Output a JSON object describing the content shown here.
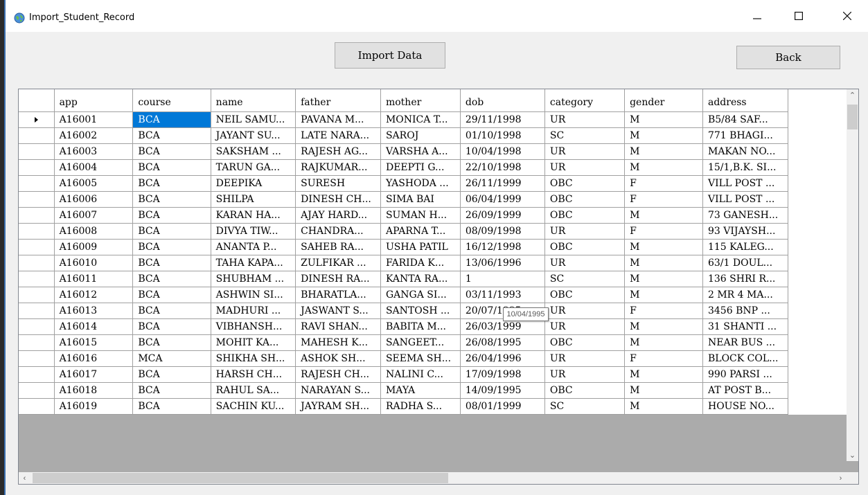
{
  "window": {
    "title": "Import_Student_Record",
    "minimize_icon": "minimize-icon",
    "maximize_icon": "maximize-icon",
    "close_icon": "close-icon"
  },
  "buttons": {
    "import": "Import Data",
    "back": "Back"
  },
  "table": {
    "columns": [
      "app",
      "course",
      "name",
      "father",
      "mother",
      "dob",
      "category",
      "gender",
      "address"
    ],
    "rows": [
      [
        "A16001",
        "BCA",
        "NEIL SAMU...",
        "PAVANA M...",
        "MONICA T...",
        "29/11/1998",
        "UR",
        "M",
        "B5/84 SAF..."
      ],
      [
        "A16002",
        "BCA",
        "JAYANT SU...",
        "LATE NARA...",
        "SAROJ",
        "01/10/1998",
        "SC",
        "M",
        "771 BHAGI..."
      ],
      [
        "A16003",
        "BCA",
        "SAKSHAM ...",
        "RAJESH AG...",
        "VARSHA A...",
        "10/04/1998",
        "UR",
        "M",
        "MAKAN NO..."
      ],
      [
        "A16004",
        "BCA",
        "TARUN GA...",
        "RAJKUMAR...",
        "DEEPTI G...",
        "22/10/1998",
        "UR",
        "M",
        "15/1,B.K. SI..."
      ],
      [
        "A16005",
        "BCA",
        "DEEPIKA",
        "SURESH",
        "YASHODA ...",
        "26/11/1999",
        "OBC",
        "F",
        "VILL POST ..."
      ],
      [
        "A16006",
        "BCA",
        "SHILPA",
        "DINESH CH...",
        "SIMA BAI",
        "06/04/1999",
        "OBC",
        "F",
        "VILL POST ..."
      ],
      [
        "A16007",
        "BCA",
        "KARAN HA...",
        "AJAY HARD...",
        "SUMAN H...",
        "26/09/1999",
        "OBC",
        "M",
        "73 GANESH..."
      ],
      [
        "A16008",
        "BCA",
        "DIVYA TIW...",
        "CHANDRA...",
        "APARNA T...",
        "08/09/1998",
        "UR",
        "F",
        "93 VIJAYSH..."
      ],
      [
        "A16009",
        "BCA",
        "ANANTA P...",
        "SAHEB RA...",
        "USHA PATIL",
        "16/12/1998",
        "OBC",
        "M",
        "115 KALEG..."
      ],
      [
        "A16010",
        "BCA",
        "TAHA KAPA...",
        "ZULFIKAR ...",
        "FARIDA K...",
        "13/06/1996",
        "UR",
        "M",
        "63/1 DOUL..."
      ],
      [
        "A16011",
        "BCA",
        "SHUBHAM ...",
        "DINESH RA...",
        "KANTA RA...",
        "1",
        "SC",
        "M",
        "136 SHRI R..."
      ],
      [
        "A16012",
        "BCA",
        "ASHWIN SI...",
        "BHARATLA...",
        "GANGA SI...",
        "03/11/1993",
        "OBC",
        "M",
        "2 MR 4 MA..."
      ],
      [
        "A16013",
        "BCA",
        "MADHURI ...",
        "JASWANT S...",
        "SANTOSH ...",
        "20/07/1995",
        "UR",
        "F",
        "3456 BNP ..."
      ],
      [
        "A16014",
        "BCA",
        "VIBHANSH...",
        "RAVI SHAN...",
        "BABITA M...",
        "26/03/1999",
        "UR",
        "M",
        "31 SHANTI ..."
      ],
      [
        "A16015",
        "BCA",
        "MOHIT KA...",
        "MAHESH K...",
        "SANGEET...",
        "26/08/1995",
        "OBC",
        "M",
        "NEAR BUS ..."
      ],
      [
        "A16016",
        "MCA",
        "SHIKHA SH...",
        "ASHOK SH...",
        "SEEMA SH...",
        "26/04/1996",
        "UR",
        "F",
        "BLOCK COL..."
      ],
      [
        "A16017",
        "BCA",
        "HARSH CH...",
        "RAJESH CH...",
        "NALINI C...",
        "17/09/1998",
        "UR",
        "M",
        "990 PARSI ..."
      ],
      [
        "A16018",
        "BCA",
        "RAHUL SA...",
        "NARAYAN S...",
        "MAYA",
        "14/09/1995",
        "OBC",
        "M",
        "AT POST B..."
      ],
      [
        "A16019",
        "BCA",
        "SACHIN KU...",
        "JAYRAM SH...",
        "RADHA S...",
        "08/01/1999",
        "SC",
        "M",
        "HOUSE NO..."
      ]
    ],
    "selected": {
      "row": 0,
      "col": 1
    },
    "current_row_icon": "row-pointer-icon"
  },
  "tooltip": {
    "text": "10/04/1995"
  },
  "colors": {
    "selection": "#0078d7",
    "grid_lines": "#a0a0a0",
    "background": "#f0f0f0"
  }
}
